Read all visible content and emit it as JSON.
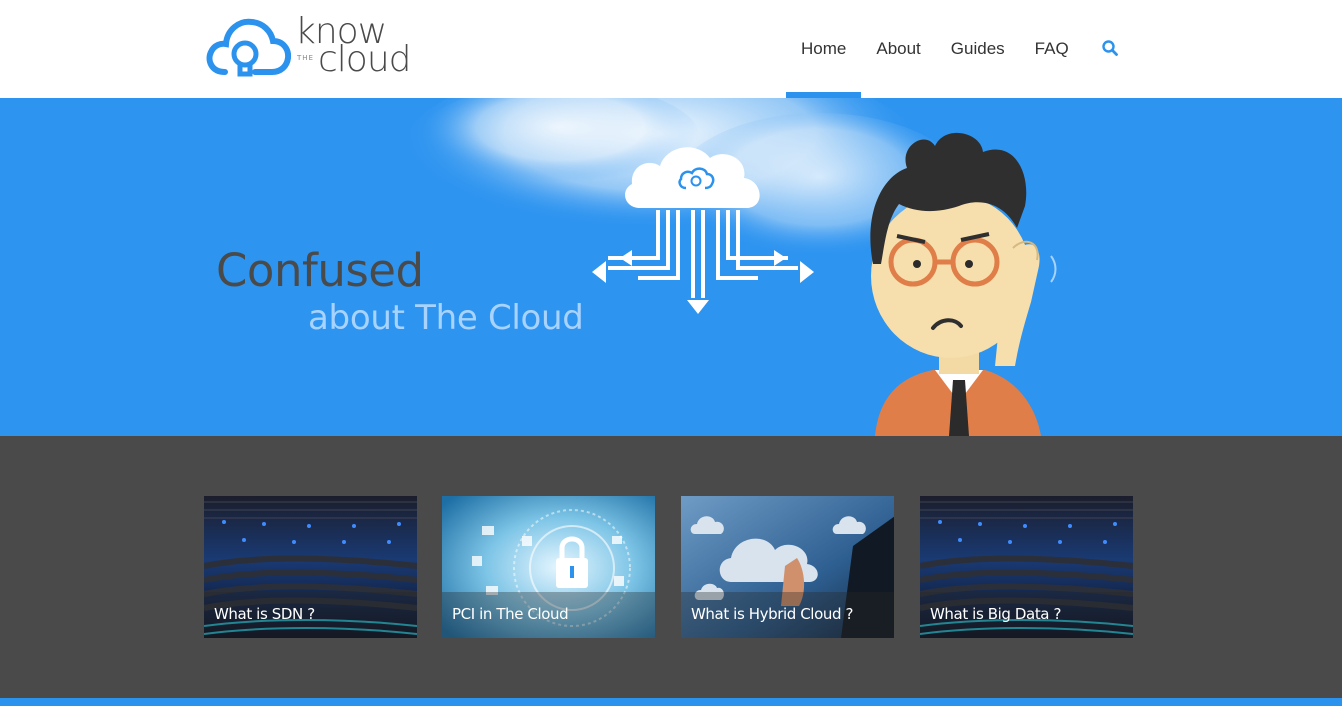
{
  "logo": {
    "know": "know",
    "the": "THE",
    "cloud": "cloud"
  },
  "nav": {
    "items": [
      {
        "label": "Home",
        "active": true
      },
      {
        "label": "About",
        "active": false
      },
      {
        "label": "Guides",
        "active": false
      },
      {
        "label": "FAQ",
        "active": false
      }
    ],
    "search_icon": "search-icon"
  },
  "hero": {
    "title": "Confused",
    "subtitle": "about The Cloud"
  },
  "cards": [
    {
      "caption": "What is SDN ?",
      "image": "server-rack"
    },
    {
      "caption": "PCI in The Cloud",
      "image": "security-lock"
    },
    {
      "caption": "What is Hybrid Cloud ?",
      "image": "cloud-touch"
    },
    {
      "caption": "What is Big Data ?",
      "image": "server-rack"
    }
  ],
  "colors": {
    "brand_blue": "#2b92ed",
    "hero_blue": "#2d94f0",
    "dark_section": "#4a4a4a",
    "text_dark": "#333333"
  }
}
